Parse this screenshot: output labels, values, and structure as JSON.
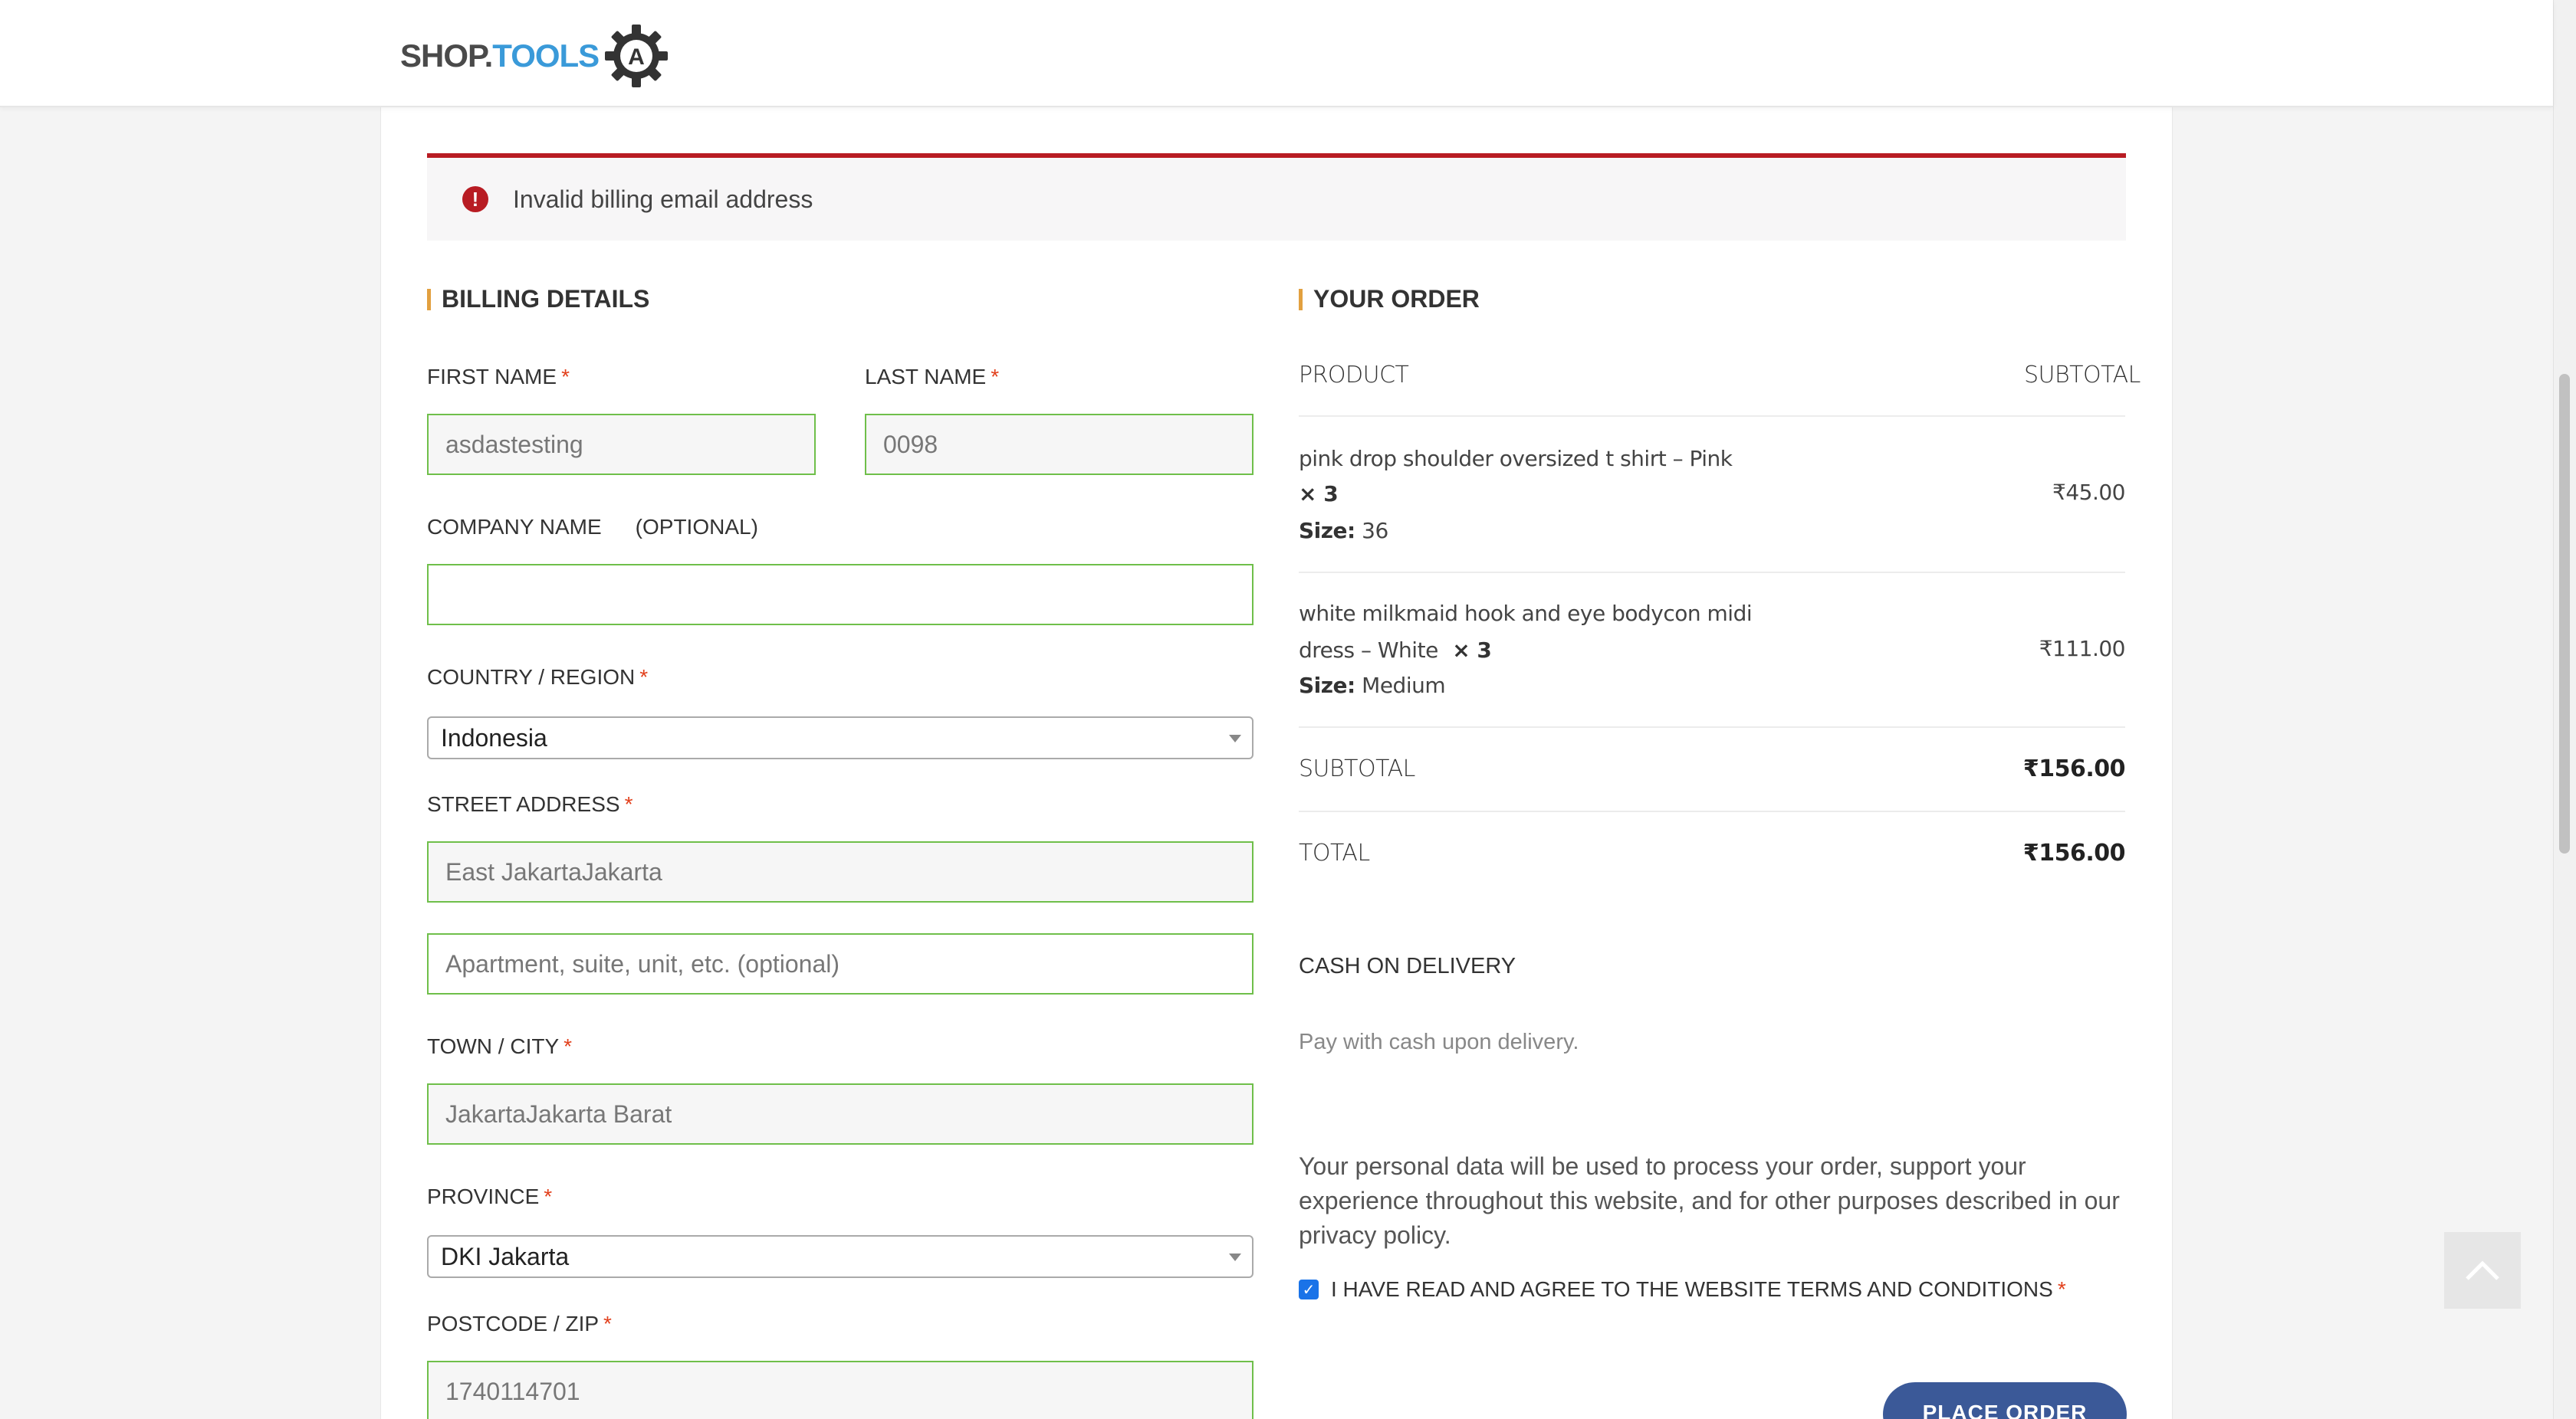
{
  "header": {
    "logo_shop": "SHOP.",
    "logo_tools": "TOOLS",
    "logo_badge": "A"
  },
  "notice": {
    "icon": "error-icon",
    "message": "Invalid billing email address"
  },
  "billing": {
    "title": "BILLING DETAILS",
    "first_name": {
      "label": "FIRST NAME",
      "required": "*",
      "value": "asdastesting"
    },
    "last_name": {
      "label": "LAST NAME",
      "required": "*",
      "value": "0098"
    },
    "company": {
      "label": "COMPANY NAME",
      "optional": "(OPTIONAL)",
      "value": ""
    },
    "country": {
      "label": "COUNTRY / REGION",
      "required": "*",
      "value": "Indonesia"
    },
    "street": {
      "label": "STREET ADDRESS",
      "required": "*",
      "value": "East JakartaJakarta",
      "placeholder2": "Apartment, suite, unit, etc. (optional)"
    },
    "city": {
      "label": "TOWN / CITY",
      "required": "*",
      "value": "JakartaJakarta Barat"
    },
    "province": {
      "label": "PROVINCE",
      "required": "*",
      "value": "DKI Jakarta"
    },
    "postcode": {
      "label": "POSTCODE / ZIP",
      "required": "*",
      "value": "1740114701"
    }
  },
  "order": {
    "title": "YOUR ORDER",
    "col_product": "PRODUCT",
    "col_subtotal": "SUBTOTAL",
    "items": [
      {
        "name_line1": "pink drop shoulder oversized t shirt – Pink",
        "name_line2": "",
        "qty": "× 3",
        "size_label": "Size:",
        "size_value": "36",
        "price": "₹45.00"
      },
      {
        "name_line1": "white milkmaid hook and eye bodycon midi",
        "name_line2": "dress – White",
        "qty": "× 3",
        "size_label": "Size:",
        "size_value": "Medium",
        "price": "₹111.00"
      }
    ],
    "subtotal_label": "SUBTOTAL",
    "subtotal_value": "₹156.00",
    "total_label": "TOTAL",
    "total_value": "₹156.00",
    "payment_method": "CASH ON DELIVERY",
    "payment_desc": "Pay with cash upon delivery.",
    "privacy_text": "Your personal data will be used to process your order, support your experience throughout this website, and for other purposes described in our privacy policy.",
    "terms_label": "I HAVE READ AND AGREE TO THE WEBSITE TERMS AND CONDITIONS",
    "terms_required": "*",
    "place_order": "PLACE ORDER"
  },
  "colors": {
    "accent": "#e2a03f",
    "error": "#b81c23",
    "field_border": "#6fbf4a",
    "button": "#3b5998",
    "logo_blue": "#3a9ad9"
  }
}
